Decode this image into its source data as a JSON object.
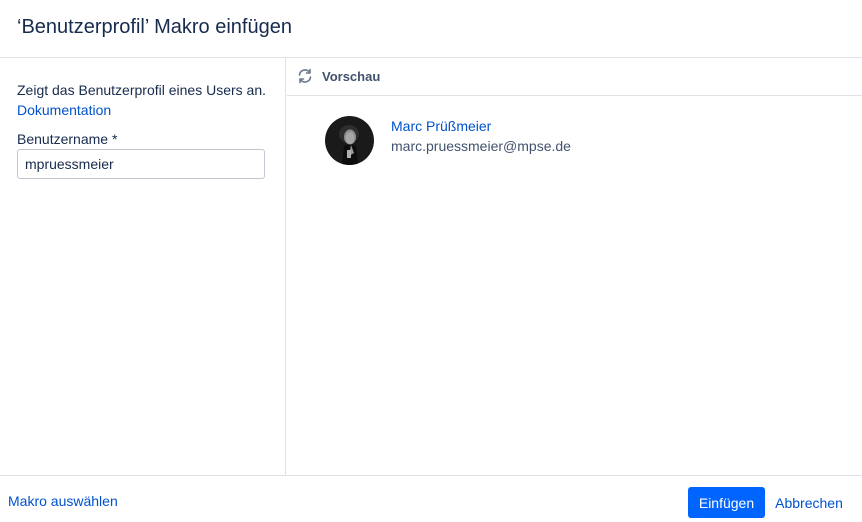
{
  "dialog": {
    "title": "‘Benutzerprofil’ Makro einfügen"
  },
  "left_panel": {
    "description": "Zeigt das Benutzerprofil eines Users an.",
    "doc_link": "Dokumentation",
    "field_label": "Benutzername *",
    "field_value": "mpruessmeier"
  },
  "preview": {
    "label": "Vorschau",
    "icon": "refresh-icon"
  },
  "profile": {
    "name": "Marc Prüßmeier",
    "email": "marc.pruessmeier@mpse.de",
    "avatar_icon": "user-avatar"
  },
  "footer": {
    "back_link": "Makro auswählen",
    "insert_button": "Einfügen",
    "cancel_button": "Abbrechen"
  },
  "colors": {
    "primary": "#0065ff",
    "link": "#0052cc",
    "text": "#172b4d",
    "border": "#dfe1e6"
  }
}
